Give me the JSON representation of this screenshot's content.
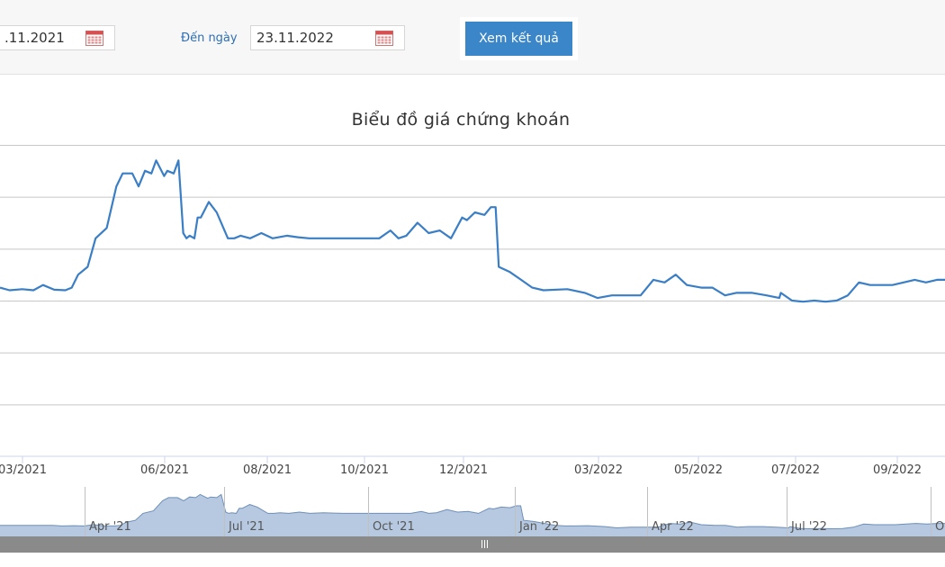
{
  "filter": {
    "from_date": ".11.2021",
    "to_label": "Đến ngày",
    "to_date": "23.11.2022",
    "submit_label": "Xem kết quả"
  },
  "colors": {
    "line": "#3a7ec6",
    "navigator_fill": "#a9bfda",
    "navigator_line": "#6d8fb8",
    "scrollbar": "#8a8a8a",
    "button": "#3a86c8"
  },
  "icons": {
    "calendar": "calendar-icon"
  },
  "chart_data": {
    "type": "line",
    "title": "Biểu đồ giá chứng khoán",
    "x_ticks": [
      "03/2021",
      "06/2021",
      "08/2021",
      "10/2021",
      "12/2021",
      "03/2022",
      "05/2022",
      "07/2022",
      "09/2022"
    ],
    "navigator_ticks": [
      "Apr '21",
      "Jul '21",
      "Oct '21",
      "Jan '22",
      "Apr '22",
      "Jul '22",
      "O"
    ],
    "y_label": "",
    "grid": true,
    "legend": "none",
    "x_range": [
      "2021-02-19",
      "2022-10-05"
    ],
    "y_range": [
      0,
      6
    ],
    "series": [
      {
        "x": [
          "2021-02-19",
          "2021-02-25",
          "2021-03-05",
          "2021-03-12",
          "2021-03-18",
          "2021-03-25",
          "2021-04-01",
          "2021-04-05",
          "2021-04-09",
          "2021-04-15",
          "2021-04-20",
          "2021-04-27",
          "2021-05-03",
          "2021-05-07",
          "2021-05-13",
          "2021-05-17",
          "2021-05-21",
          "2021-05-25",
          "2021-05-28",
          "2021-06-02",
          "2021-06-04",
          "2021-06-08",
          "2021-06-11",
          "2021-06-14",
          "2021-06-16",
          "2021-06-18",
          "2021-06-21",
          "2021-06-23",
          "2021-06-25",
          "2021-06-30",
          "2021-07-05",
          "2021-07-12",
          "2021-07-16",
          "2021-07-20",
          "2021-07-26",
          "2021-08-02",
          "2021-08-09",
          "2021-08-18",
          "2021-08-25",
          "2021-09-01",
          "2021-09-09",
          "2021-09-20",
          "2021-10-01",
          "2021-10-08",
          "2021-10-15",
          "2021-10-22",
          "2021-10-27",
          "2021-11-01",
          "2021-11-08",
          "2021-11-15",
          "2021-11-22",
          "2021-11-29",
          "2021-12-06",
          "2021-12-09",
          "2021-12-14",
          "2021-12-20",
          "2021-12-24",
          "2021-12-27",
          "2021-12-29",
          "2022-01-05",
          "2022-01-12",
          "2022-01-19",
          "2022-01-26",
          "2022-02-10",
          "2022-02-21",
          "2022-03-01",
          "2022-03-10",
          "2022-03-18",
          "2022-03-28",
          "2022-04-05",
          "2022-04-12",
          "2022-04-19",
          "2022-04-26",
          "2022-05-05",
          "2022-05-12",
          "2022-05-20",
          "2022-05-27",
          "2022-06-06",
          "2022-06-15",
          "2022-06-23",
          "2022-06-24",
          "2022-07-01",
          "2022-07-08",
          "2022-07-15",
          "2022-07-22",
          "2022-07-29",
          "2022-08-05",
          "2022-08-12",
          "2022-08-19",
          "2022-08-26",
          "2022-09-02",
          "2022-09-09",
          "2022-09-16",
          "2022-09-23",
          "2022-09-30",
          "2022-10-05"
        ],
        "y": [
          3.25,
          3.2,
          3.22,
          3.2,
          3.3,
          3.21,
          3.2,
          3.25,
          3.5,
          3.65,
          4.2,
          4.4,
          5.2,
          5.45,
          5.45,
          5.2,
          5.5,
          5.45,
          5.7,
          5.4,
          5.5,
          5.45,
          5.7,
          4.3,
          4.2,
          4.25,
          4.2,
          4.6,
          4.6,
          4.9,
          4.7,
          4.2,
          4.2,
          4.25,
          4.2,
          4.3,
          4.2,
          4.25,
          4.22,
          4.2,
          4.2,
          4.2,
          4.2,
          4.2,
          4.2,
          4.35,
          4.2,
          4.25,
          4.5,
          4.3,
          4.35,
          4.2,
          4.6,
          4.55,
          4.7,
          4.65,
          4.8,
          4.8,
          3.65,
          3.55,
          3.4,
          3.25,
          3.2,
          3.22,
          3.15,
          3.05,
          3.1,
          3.1,
          3.1,
          3.4,
          3.35,
          3.5,
          3.3,
          3.25,
          3.25,
          3.1,
          3.15,
          3.15,
          3.1,
          3.05,
          3.15,
          3.0,
          2.98,
          3.0,
          2.98,
          3.0,
          3.1,
          3.35,
          3.3,
          3.3,
          3.3,
          3.35,
          3.4,
          3.35,
          3.4,
          3.4
        ]
      }
    ],
    "navigator_x_range": [
      "2021-01-15",
      "2022-10-05"
    ]
  }
}
